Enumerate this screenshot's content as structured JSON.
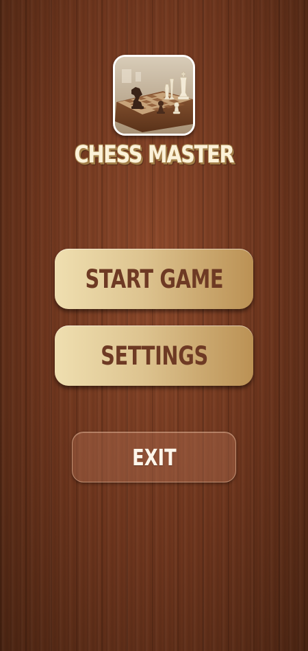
{
  "app": {
    "title": "CHESS MASTER",
    "logo_icon": "chess-board-icon"
  },
  "menu": {
    "start_label": "START GAME",
    "settings_label": "SETTINGS",
    "exit_label": "EXIT"
  },
  "colors": {
    "background_wood": "#6d351d",
    "button_gold_light": "#efdfb0",
    "button_gold_dark": "#bb9154",
    "button_text": "#6e3a24",
    "title_text": "#fbf1d8",
    "title_outline": "#a27e48"
  }
}
